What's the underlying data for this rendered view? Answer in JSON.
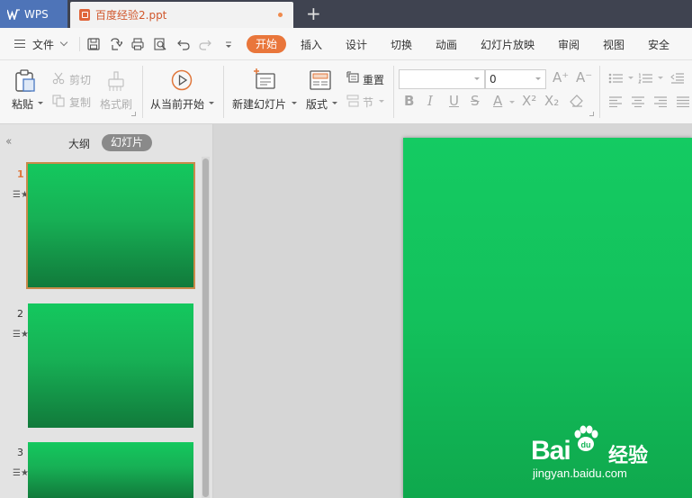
{
  "titlebar": {
    "app_tab": "WPS",
    "doc_tab": "百度经验2.ppt",
    "new_tab": "+"
  },
  "menubar": {
    "file_menu": "文件",
    "tabs": [
      {
        "label": "开始",
        "active": true
      },
      {
        "label": "插入"
      },
      {
        "label": "设计"
      },
      {
        "label": "切换"
      },
      {
        "label": "动画"
      },
      {
        "label": "幻灯片放映"
      },
      {
        "label": "审阅"
      },
      {
        "label": "视图"
      },
      {
        "label": "安全"
      }
    ]
  },
  "ribbon": {
    "paste": "粘贴",
    "cut": "剪切",
    "copy": "复制",
    "format_painter": "格式刷",
    "play_from_current": "从当前开始",
    "new_slide": "新建幻灯片",
    "layout": "版式",
    "reset": "重置",
    "section": "节",
    "font_name": "",
    "font_size": "0"
  },
  "left_pane": {
    "tab_outline": "大纲",
    "tab_slides": "幻灯片",
    "slides": [
      {
        "number": "1",
        "active": true
      },
      {
        "number": "2"
      },
      {
        "number": "3"
      }
    ]
  },
  "watermark": {
    "brand_left": "Bai",
    "brand_right": "经验",
    "url": "jingyan.baidu.com"
  },
  "colors": {
    "accent": "#e9763b",
    "wps_blue": "#4e74b8",
    "slide_green": "#14cb62"
  }
}
